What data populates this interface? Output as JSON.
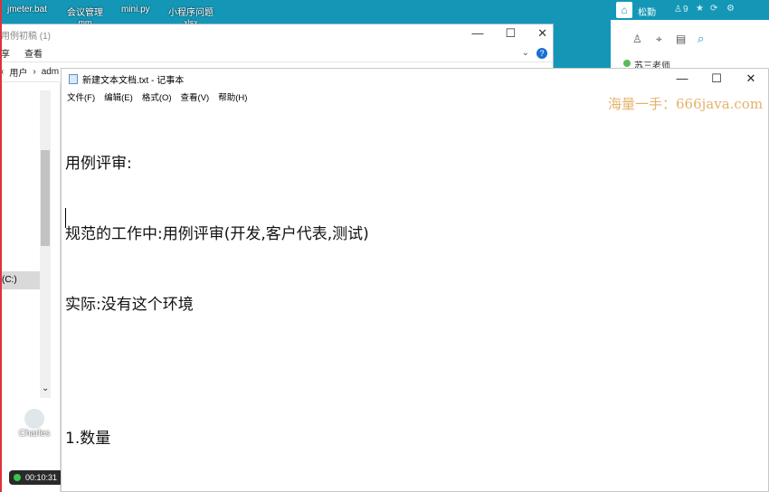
{
  "desktop": {
    "icons": [
      {
        "label": "jmeter.bat",
        "sub": ""
      },
      {
        "label": "会议管理",
        "sub": "mm"
      },
      {
        "label": "mini.py",
        "sub": ""
      },
      {
        "label": "小程序问题",
        "sub": "xlsx"
      }
    ],
    "charles_label": "Charles"
  },
  "explorer": {
    "title": "用例初稿 (1)",
    "ribbon": [
      "享",
      "查看"
    ],
    "breadcrumb": [
      "用户",
      "adm"
    ],
    "drive_label": "(C:)",
    "scroll_down": "⌄"
  },
  "notepad": {
    "title": "新建文本文档.txt - 记事本",
    "menu": [
      "文件(F)",
      "编辑(E)",
      "格式(O)",
      "查看(V)",
      "帮助(H)"
    ],
    "lines": [
      "用例评审:",
      "规范的工作中:用例评审(开发,客户代表,测试)",
      "实际:没有这个环境",
      "",
      "1.数量"
    ]
  },
  "watermark": "海量一手：666java.com",
  "qq": {
    "user": "松勤",
    "count": "9",
    "contact": "苏三老师"
  },
  "recorder": {
    "time": "00:10:31"
  },
  "colors": {
    "desktop": "#1497b7",
    "accent": "#1497b7"
  }
}
